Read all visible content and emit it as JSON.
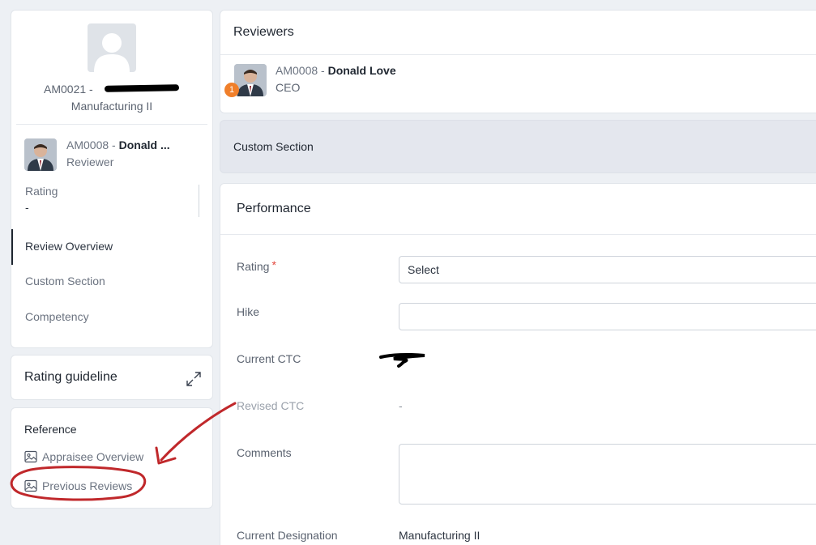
{
  "employee": {
    "id_prefix": "AM0021 -",
    "department": "Manufacturing II"
  },
  "current_reviewer": {
    "id": "AM0008",
    "separator": " - ",
    "name": "Donald ...",
    "role": "Reviewer"
  },
  "rating_summary": {
    "label": "Rating",
    "value": "-"
  },
  "nav": {
    "items": [
      "Review Overview",
      "Custom Section",
      "Competency"
    ]
  },
  "guideline": {
    "title": "Rating guideline"
  },
  "reference": {
    "title": "Reference",
    "items": [
      "Appraisee Overview",
      "Previous Reviews"
    ]
  },
  "reviewers": {
    "title": "Reviewers",
    "list": [
      {
        "id": "AM0008",
        "separator": " - ",
        "name": "Donald Love",
        "role": "CEO",
        "badge": "1"
      }
    ]
  },
  "custom_section": {
    "title": "Custom Section"
  },
  "performance": {
    "title": "Performance",
    "fields": {
      "rating": {
        "label": "Rating",
        "required_mark": "*",
        "value": "Select"
      },
      "hike": {
        "label": "Hike",
        "value": ""
      },
      "current_ctc": {
        "label": "Current CTC"
      },
      "revised_ctc": {
        "label": "Revised CTC",
        "value": "-"
      },
      "comments": {
        "label": "Comments",
        "value": ""
      },
      "current_designation": {
        "label": "Current Designation",
        "value": "Manufacturing II"
      }
    }
  },
  "colors": {
    "accent_badge": "#f07f2a",
    "annotation_red": "#c0282b",
    "required_red": "#e2463c"
  }
}
